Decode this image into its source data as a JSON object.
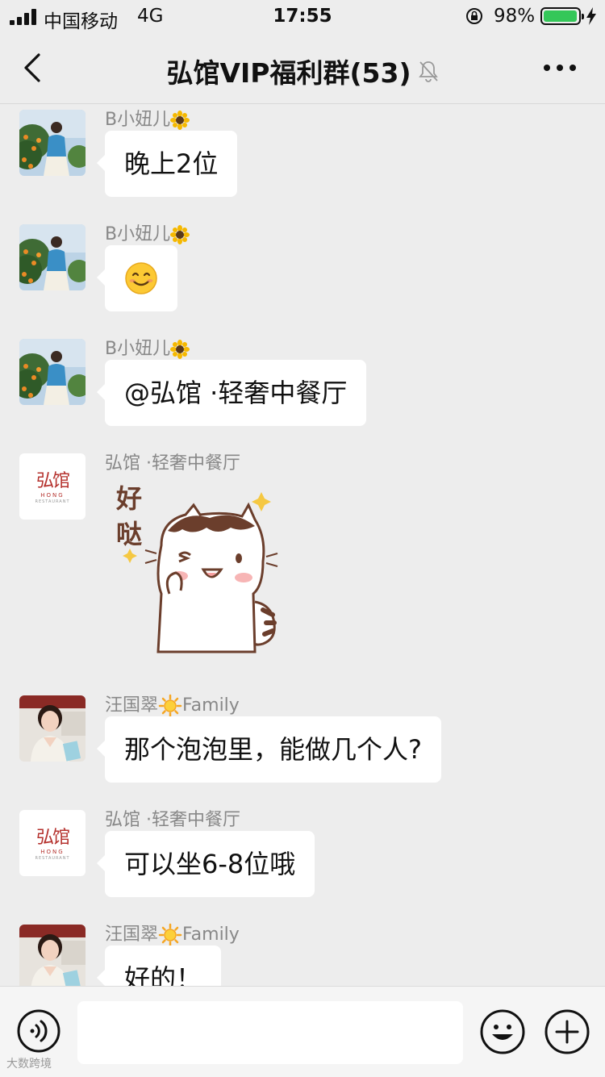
{
  "status_bar": {
    "carrier": "中国移动",
    "network": "4G",
    "time": "17:55",
    "battery_percent": "98%",
    "battery_level": 0.98,
    "battery_color": "#34c759"
  },
  "nav": {
    "title": "弘馆VIP福利群(53)",
    "back_icon": "chevron-left-icon",
    "mute_icon": "bell-muted-icon",
    "more_icon": "more-icon"
  },
  "messages": [
    {
      "sender": "B小妞儿",
      "sender_emoji": "sunflower-icon",
      "text": "晚上2位"
    },
    {
      "sender": "B小妞儿",
      "sender_emoji": "sunflower-icon",
      "text": "😊"
    },
    {
      "sender": "B小妞儿",
      "sender_emoji": "sunflower-icon",
      "text": "@弘馆 ·轻奢中餐厅"
    },
    {
      "sender": "弘馆 ·轻奢中餐厅",
      "sticker_text": "好哒",
      "sticker": "cat-sticker"
    },
    {
      "sender": "汪国翠",
      "sender_emoji": "sun-icon",
      "sender_suffix": "Family",
      "text": "那个泡泡里，能做几个人?"
    },
    {
      "sender": "弘馆 ·轻奢中餐厅",
      "text": "可以坐6-8位哦"
    },
    {
      "sender": "汪国翠",
      "sender_emoji": "sun-icon",
      "sender_suffix": "Family",
      "text": "好的！"
    }
  ],
  "restaurant_logo": {
    "main": "弘馆",
    "sub": "HONG",
    "sub2": "RESTAURANT"
  },
  "input_bar": {
    "voice_icon": "voice-icon",
    "emoji_icon": "emoji-icon",
    "plus_icon": "plus-icon"
  },
  "watermark": "大数跨境"
}
